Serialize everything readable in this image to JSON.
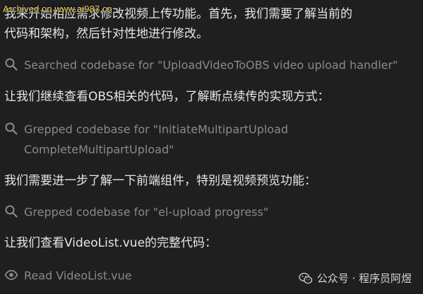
{
  "watermark": "Archived on www.ai987.cn",
  "messages": {
    "m1_line1": "我来开始相应需求修改视频上传功能。首先，我们需要了解当前的",
    "m1_line2": "代码和架构，然后针对性地进行修改。",
    "m2": "让我们继续查看OBS相关的代码，了解断点续传的实现方式：",
    "m3": "我们需要进一步了解一下前端组件，特别是视频预览功能：",
    "m4": "让我们查看VideoList.vue的完整代码："
  },
  "tools": {
    "t1": "Searched codebase for \"UploadVideoToOBS video upload handler\"",
    "t2_line1": "Grepped codebase for \"InitiateMultipartUpload",
    "t2_line2": "CompleteMultipartUpload\"",
    "t3": "Grepped codebase for \"el-upload progress\"",
    "t4": "Read VideoList.vue"
  },
  "footer": {
    "brand": "公众号 · 程序员阿煜"
  },
  "icons": {
    "search": "search-icon",
    "eye": "eye-icon",
    "wechat": "wechat-logo-icon"
  },
  "colors": {
    "background": "#1f1f1f",
    "message_text": "#e6e6e6",
    "tool_text": "#8a8a8a",
    "watermark": "#f2d94e"
  }
}
